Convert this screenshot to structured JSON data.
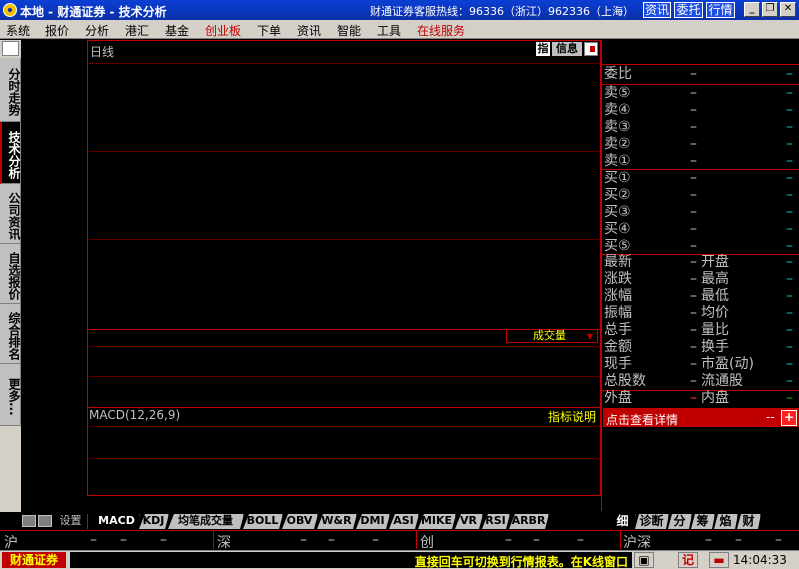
{
  "titlebar": {
    "title": "本地 - 财通证券 - 技术分析",
    "hotline": "财通证券客服热线：96336（浙江）962336（上海）",
    "buttons": [
      "资讯",
      "委托",
      "行情"
    ]
  },
  "menu": {
    "items": [
      "系统",
      "报价",
      "分析",
      "港汇",
      "基金",
      "创业板",
      "下单",
      "资讯",
      "智能",
      "工具",
      "在线服务"
    ]
  },
  "left_tabs": [
    "分时走势",
    "技术分析",
    "公司资讯",
    "自选报价",
    "综合排名",
    "更多..."
  ],
  "chart": {
    "period_label": "日线",
    "icon_label": "指",
    "info_label": "信息",
    "volume_selector": "成交量",
    "macd_label": "MACD(12,26,9)",
    "indicator_help": "指标说明"
  },
  "quote_panel": {
    "weibi_label": "委比",
    "sell_rows": [
      "卖⑤",
      "卖④",
      "卖③",
      "卖②",
      "卖①"
    ],
    "buy_rows": [
      "买①",
      "买②",
      "买③",
      "买④",
      "买⑤"
    ],
    "stats_left": [
      "最新",
      "涨跌",
      "涨幅",
      "振幅",
      "总手",
      "金额",
      "现手",
      "总股数"
    ],
    "stats_right": [
      "开盘",
      "最高",
      "最低",
      "均价",
      "量比",
      "换手",
      "市盈(动)",
      "流通股"
    ],
    "outer_label": "外盘",
    "inner_label": "内盘",
    "dash": "–",
    "detail_link": "点击查看详情",
    "detail_dash": "--",
    "detail_plus": "+"
  },
  "bottom_tabs": {
    "settings": "设置",
    "indicators": [
      "MACD",
      "KDJ",
      "均笔成交量",
      "BOLL",
      "OBV",
      "W&R",
      "DMI",
      "ASI",
      "MIKE",
      "VR",
      "RSI",
      "ARBR"
    ],
    "right_tabs": [
      "细",
      "诊断",
      "分",
      "筹",
      "焰",
      "财"
    ]
  },
  "index_row": {
    "items": [
      "沪",
      "深",
      "创",
      "沪深"
    ],
    "dash": "–"
  },
  "statusbar": {
    "brand": "财通证券",
    "ticker": "直接回车可切换到行情报表。在K线窗口",
    "note_icon": "记",
    "clock": "14:04:33"
  }
}
